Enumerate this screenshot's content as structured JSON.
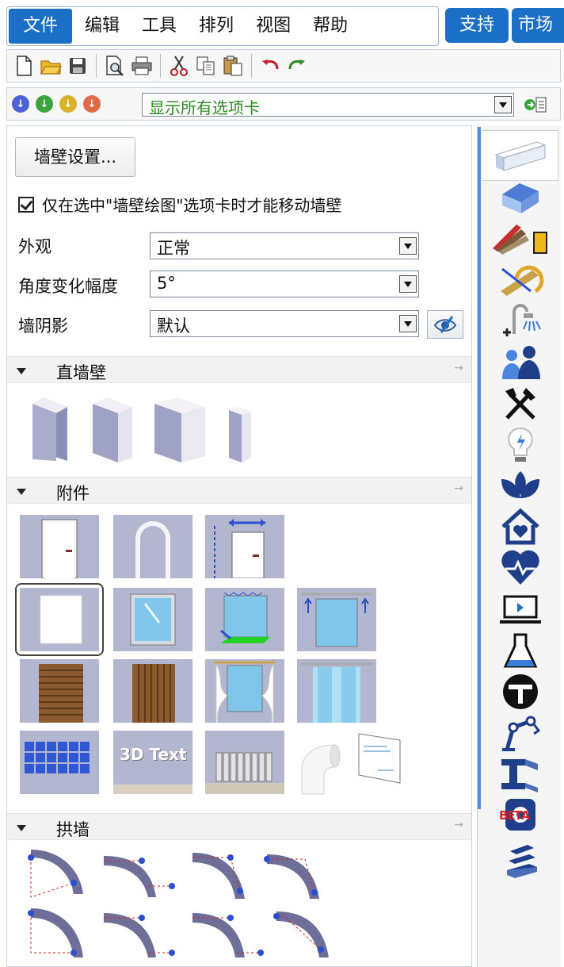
{
  "menu": {
    "items": [
      {
        "label": "文件",
        "active": true
      },
      {
        "label": "编辑"
      },
      {
        "label": "工具"
      },
      {
        "label": "排列"
      },
      {
        "label": "视图"
      },
      {
        "label": "帮助"
      }
    ],
    "support_label": "支持",
    "market_label": "市场"
  },
  "toolbar": {
    "icons": [
      "new-file-icon",
      "open-folder-icon",
      "save-icon",
      "print-preview-icon",
      "print-icon",
      "cut-icon",
      "copy-icon",
      "paste-icon",
      "undo-icon",
      "redo-icon"
    ]
  },
  "tab_filter": {
    "selected": "显示所有选项卡",
    "arrow_colors": [
      "#4b63d6",
      "#3aa53a",
      "#d9b22a",
      "#e06a4a"
    ]
  },
  "wall_panel": {
    "settings_button": "墙壁设置...",
    "move_only_checkbox_label": "仅在选中\"墙壁绘图\"选项卡时才能移动墙壁",
    "move_only_checked": true,
    "appearance_label": "外观",
    "appearance_value": "正常",
    "angle_label": "角度变化幅度",
    "angle_value": "5°",
    "shadow_label": "墙阴影",
    "shadow_value": "默认"
  },
  "sections": {
    "straight_walls": "直墙壁",
    "attachments": "附件",
    "arched_walls": "拱墙"
  },
  "attachment_tiles": {
    "text_tile_label": "3D Text"
  },
  "category_icons": [
    "wall-icon",
    "house-icon",
    "materials-icon",
    "measure-icon",
    "shower-icon",
    "people-icon",
    "kitchen-tools-icon",
    "bulb-icon",
    "lotus-icon",
    "home-heart-icon",
    "heart-pulse-icon",
    "laptop-icon",
    "flask-icon",
    "tool-logo-icon",
    "robot-arm-icon",
    "steel-beam-icon",
    "beta-icon",
    "stairs-icon"
  ],
  "beta_label": "BETA",
  "colors": {
    "accent": "#1c6fc6",
    "filter_text": "#2e8b22",
    "tile_bg": "#b3b6cf"
  }
}
